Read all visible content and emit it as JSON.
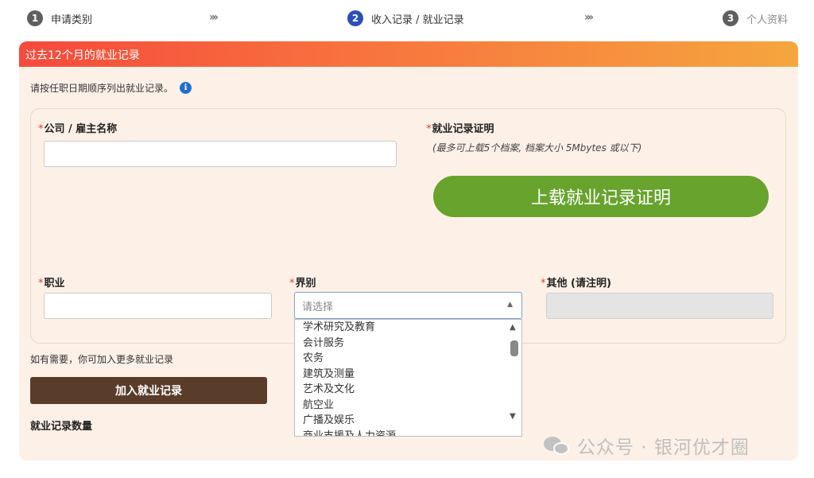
{
  "steps": [
    {
      "num": "1",
      "label": "申请类别"
    },
    {
      "num": "2",
      "label": "收入记录 / 就业记录"
    },
    {
      "num": "3",
      "label": "个人资料"
    }
  ],
  "chevron": "»»",
  "section": {
    "title": "过去12个月的就业记录",
    "intro": "请按任职日期顺序列出就业记录。",
    "info_icon": "i"
  },
  "form": {
    "company_label": "公司 / 雇主名称",
    "proof_label": "就业记录证明",
    "proof_hint": "(最多可上载5个档案, 档案大小 5Mbytes 或以下)",
    "upload_button": "上载就业记录证明",
    "occupation_label": "职业",
    "industry_label": "界别",
    "other_label": "其他 (请注明)",
    "required_mark": "*",
    "industry_select": {
      "placeholder": "请选择",
      "options": [
        "学术研究及教育",
        "会计服务",
        "农务",
        "建筑及测量",
        "艺术及文化",
        "航空业",
        "广播及娱乐",
        "商业支援及人力资源"
      ]
    }
  },
  "more_text": "如有需要，你可加入更多就业记录",
  "add_button": "加入就业记录",
  "count_label": "就业记录数量",
  "watermark": "公众号 · 银河优才圈",
  "colors": {
    "accent_green": "#67a32d",
    "step_active": "#2a4fb8",
    "header_start": "#f54a3c",
    "header_end": "#f5a63e",
    "brown_button": "#5a3c2a"
  }
}
